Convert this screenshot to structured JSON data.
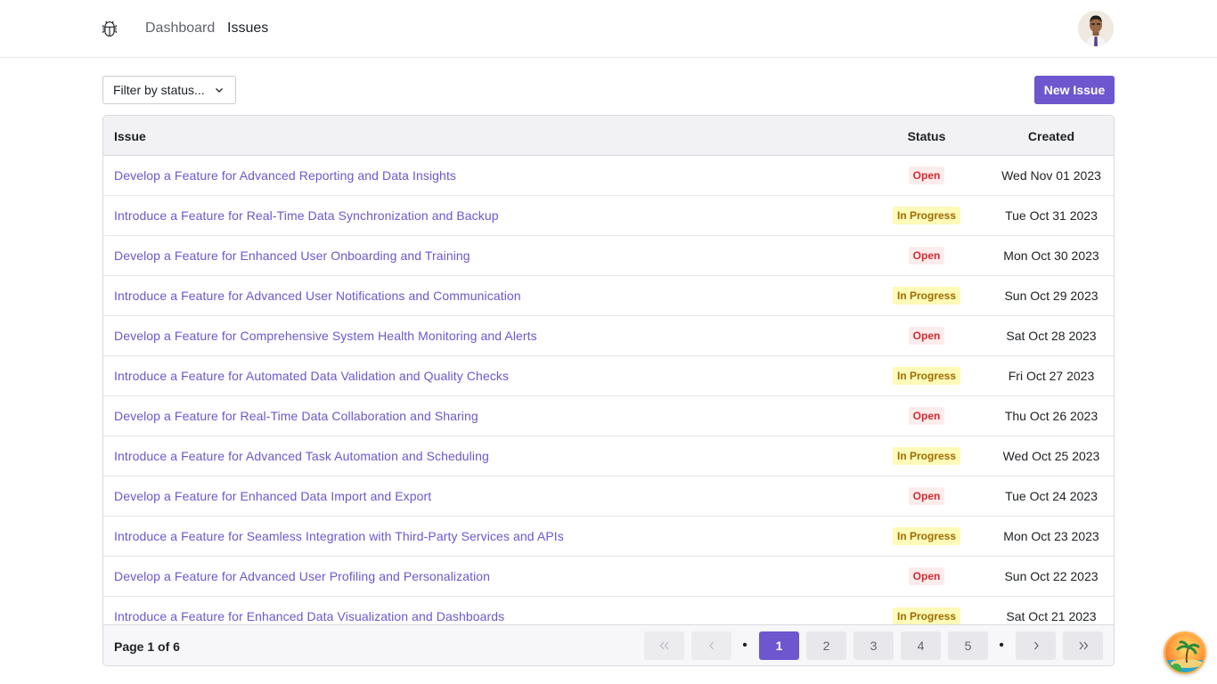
{
  "nav": {
    "logo_icon": "bug-icon",
    "links": [
      "Dashboard",
      "Issues"
    ],
    "avatar_icon": "user-avatar"
  },
  "toolbar": {
    "filter_placeholder": "Filter by status...",
    "new_issue_label": "New Issue"
  },
  "table": {
    "headers": {
      "issue": "Issue",
      "status": "Status",
      "created": "Created"
    },
    "rows": [
      {
        "title": "Develop a Feature for Advanced Reporting and Data Insights",
        "status": "Open",
        "created": "Wed Nov 01 2023"
      },
      {
        "title": "Introduce a Feature for Real-Time Data Synchronization and Backup",
        "status": "In Progress",
        "created": "Tue Oct 31 2023"
      },
      {
        "title": "Develop a Feature for Enhanced User Onboarding and Training",
        "status": "Open",
        "created": "Mon Oct 30 2023"
      },
      {
        "title": "Introduce a Feature for Advanced User Notifications and Communication",
        "status": "In Progress",
        "created": "Sun Oct 29 2023"
      },
      {
        "title": "Develop a Feature for Comprehensive System Health Monitoring and Alerts",
        "status": "Open",
        "created": "Sat Oct 28 2023"
      },
      {
        "title": "Introduce a Feature for Automated Data Validation and Quality Checks",
        "status": "In Progress",
        "created": "Fri Oct 27 2023"
      },
      {
        "title": "Develop a Feature for Real-Time Data Collaboration and Sharing",
        "status": "Open",
        "created": "Thu Oct 26 2023"
      },
      {
        "title": "Introduce a Feature for Advanced Task Automation and Scheduling",
        "status": "In Progress",
        "created": "Wed Oct 25 2023"
      },
      {
        "title": "Develop a Feature for Enhanced Data Import and Export",
        "status": "Open",
        "created": "Tue Oct 24 2023"
      },
      {
        "title": "Introduce a Feature for Seamless Integration with Third-Party Services and APIs",
        "status": "In Progress",
        "created": "Mon Oct 23 2023"
      },
      {
        "title": "Develop a Feature for Advanced User Profiling and Personalization",
        "status": "Open",
        "created": "Sun Oct 22 2023"
      },
      {
        "title": "Introduce a Feature for Enhanced Data Visualization and Dashboards",
        "status": "In Progress",
        "created": "Sat Oct 21 2023"
      }
    ]
  },
  "pagination": {
    "page_info": "Page 1 of 6",
    "first": "«",
    "prev": "‹",
    "dots": "•",
    "pages": [
      "1",
      "2",
      "3",
      "4",
      "5"
    ],
    "current": "1",
    "next": "›",
    "last": "»"
  },
  "colors": {
    "accent": "#6e56cf",
    "open_bg": "#feebec",
    "open_text": "#ce2c31",
    "progress_bg": "#fffab8",
    "progress_text": "#9e6c00"
  }
}
